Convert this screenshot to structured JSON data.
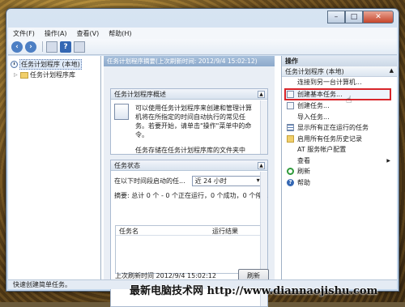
{
  "menu": [
    "文件(F)",
    "操作(A)",
    "查看(V)",
    "帮助(H)"
  ],
  "tree": {
    "root": "任务计划程序 (本地)",
    "library": "任务计划程序库"
  },
  "center": {
    "header": "任务计划程序摘要(上次刷新时间: 2012/9/4 15:02:12)",
    "overview_title": "任务计划程序概述",
    "overview_text": "可以使用任务计划程序来创建和管理计算机将在所指定的时间自动执行的常见任务。若要开始，请单击\"操作\"菜单中的命令。",
    "overview_more": "任务存储在任务计划程序库的文件夹中",
    "status_title": "任务状态",
    "status_label": "在以下时间段启动的任...",
    "status_select": "近 24 小时",
    "summary": "摘要: 总计 0 个 - 0 个正在运行，0 个成功，0 个停...",
    "col_name": "任务名",
    "col_result": "运行结果",
    "last_refresh": "上次刷新时间 2012/9/4 15:02:12",
    "refresh_btn": "刷新"
  },
  "actions": {
    "title": "操作",
    "section": "任务计划程序 (本地)",
    "items": [
      {
        "label": "连接到另一台计算机...",
        "icon": "blank"
      },
      {
        "label": "创建基本任务...",
        "icon": "doc"
      },
      {
        "label": "创建任务...",
        "icon": "doc"
      },
      {
        "label": "导入任务...",
        "icon": "blank"
      },
      {
        "label": "显示所有正在运行的任务",
        "icon": "list"
      },
      {
        "label": "启用所有任务历史记录",
        "icon": "folder"
      },
      {
        "label": "AT 服务帐户配置",
        "icon": "blank"
      },
      {
        "label": "查看",
        "icon": "blank"
      },
      {
        "label": "刷新",
        "icon": "refresh"
      },
      {
        "label": "帮助",
        "icon": "help"
      }
    ]
  },
  "statusbar": "快速创建简单任务。",
  "watermark": "最新电脑技术网 http://www.diannaojishu.com",
  "colors": {
    "highlight": "#d8252a",
    "header_blue": "#8ca9cb"
  }
}
